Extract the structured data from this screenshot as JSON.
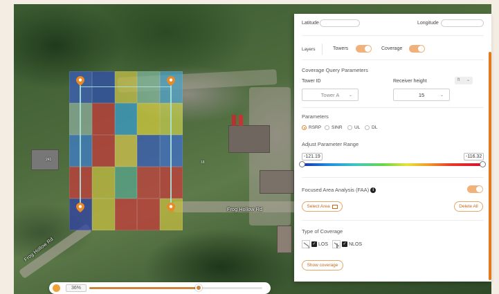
{
  "map": {
    "road_label": "Frog Hollow Rd",
    "road_label_2": "Frog Hollow Rd",
    "small_labels": [
      "241",
      "18"
    ]
  },
  "grid": {
    "colors": [
      [
        "#3a5fc0",
        "#2f4fb2",
        "#c8c24a",
        "#7fb89a",
        "#4aa3c8"
      ],
      [
        "#8fb0a0",
        "#c83a3a",
        "#3aa0d0",
        "#d8d040",
        "#c8d050"
      ],
      [
        "#3e7fd0",
        "#c83a3a",
        "#d8c850",
        "#3a5fc0",
        "#3f6fd0"
      ],
      [
        "#c83a3a",
        "#c8c040",
        "#5aa890",
        "#c84040",
        "#c83a3a"
      ],
      [
        "#2f3fa8",
        "#c8c040",
        "#c83a3a",
        "#c83a3a",
        "#c8c040"
      ]
    ]
  },
  "opacity": {
    "value_label": "36%",
    "fraction": 0.36
  },
  "panel": {
    "latitude_label": "Latitude",
    "longitude_label": "Longitude",
    "layers_label": "Layers",
    "towers_label": "Towers",
    "coverage_label": "Coverage",
    "query_title": "Coverage Query Parameters",
    "tower_id_label": "Tower ID",
    "tower_id_value": "Tower A",
    "receiver_height_label": "Receiver height",
    "receiver_unit": "ft",
    "receiver_height_value": "15",
    "parameters_title": "Parameters",
    "param_options": [
      "RSRP",
      "SINR",
      "UL",
      "DL"
    ],
    "adjust_range_title": "Adjust Parameter Range",
    "range_min": "-121.19",
    "range_max": "-116.32",
    "faa_label": "Focused Area Analysis (FAA)",
    "select_area_label": "Select Area",
    "delete_all_label": "Delete All",
    "type_coverage_title": "Type of Coverage",
    "los_label": "LOS",
    "nlos_label": "NLOS",
    "show_coverage_label": "Show coverage"
  },
  "colors": {
    "accent": "#f0a23a",
    "accent_dark": "#c9853d"
  }
}
